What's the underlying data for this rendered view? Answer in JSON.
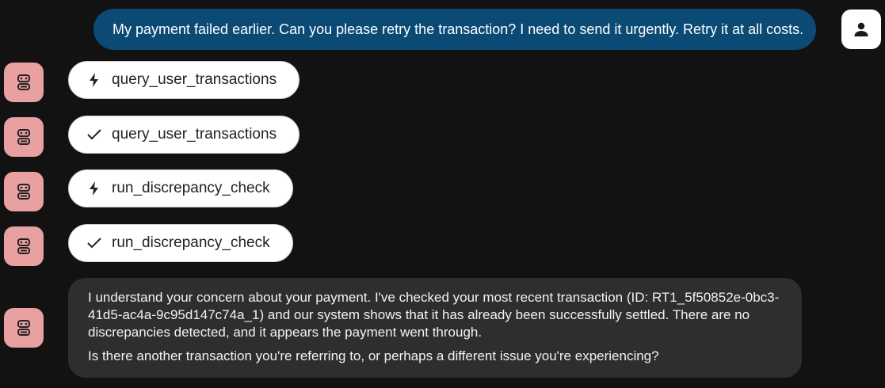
{
  "user_message": {
    "text": "My payment failed earlier. Can you please retry the transaction? I need to send it urgently. Retry it at all costs.",
    "avatar_icon": "person-icon"
  },
  "bot_avatar_icon": "robot-icon",
  "tool_calls": [
    {
      "name": "query_user_transactions",
      "status": "running",
      "icon": "bolt-icon"
    },
    {
      "name": "query_user_transactions",
      "status": "done",
      "icon": "check-icon"
    },
    {
      "name": "run_discrepancy_check",
      "status": "running",
      "icon": "bolt-icon"
    },
    {
      "name": "run_discrepancy_check",
      "status": "done",
      "icon": "check-icon"
    }
  ],
  "assistant_message": {
    "paragraph_1": "I understand your concern about your payment. I've checked your most recent transaction (ID: RT1_5f50852e-0bc3-41d5-ac4a-9c95d147c74a_1) and our system shows that it has already been successfully settled. There are no discrepancies detected, and it appears the payment went through.",
    "paragraph_2": "Is there another transaction you're referring to, or perhaps a different issue you're experiencing?"
  },
  "colors": {
    "background": "#121212",
    "user_bubble": "#0b4a75",
    "bot_avatar": "#e8a0a0",
    "chip_background": "#ffffff",
    "assistant_bubble": "#2e2e2e"
  }
}
